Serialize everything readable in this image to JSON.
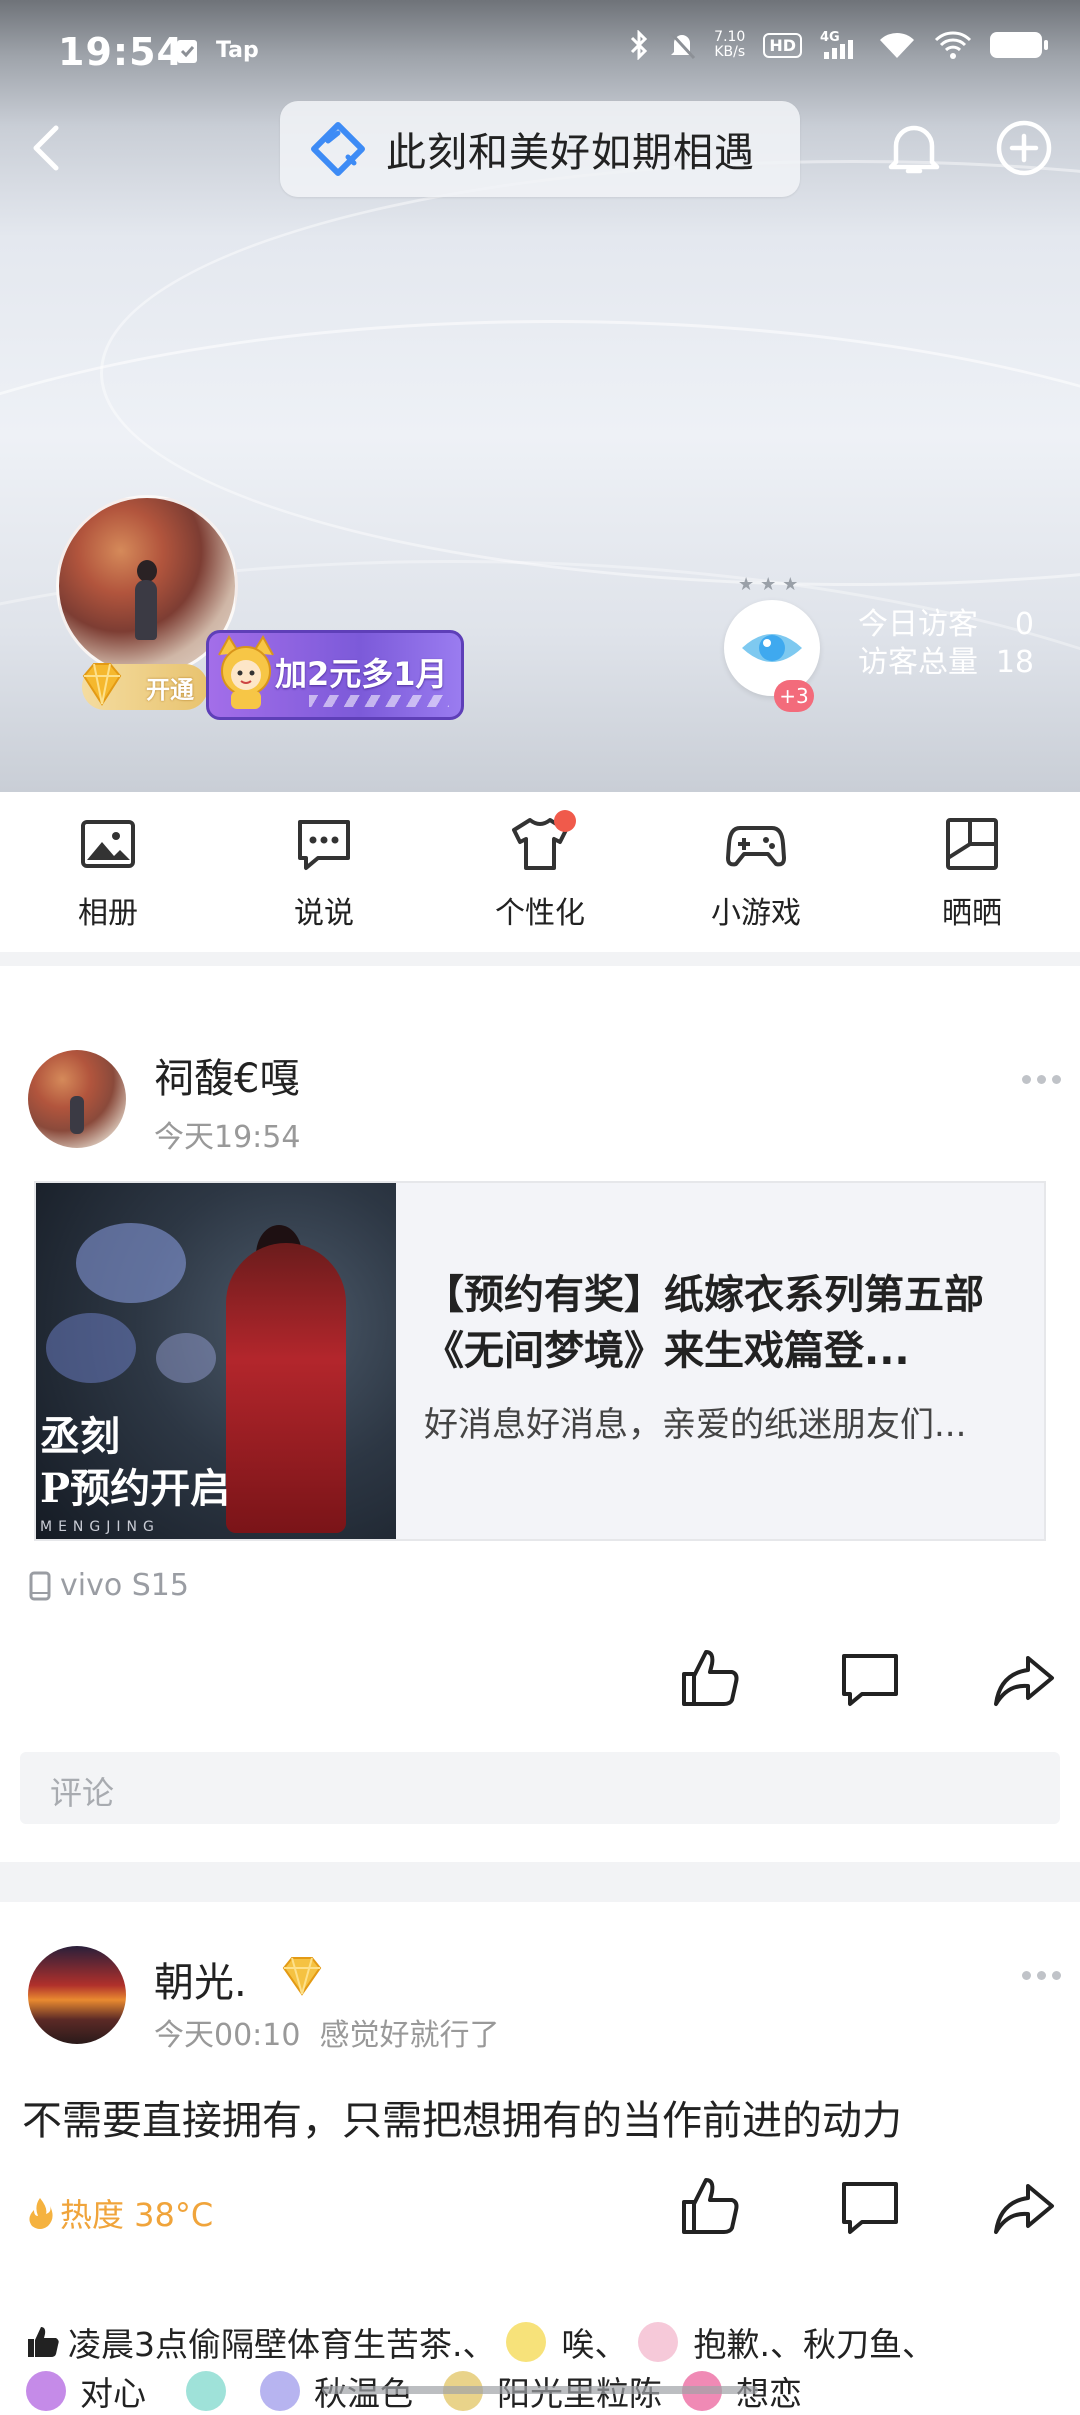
{
  "status_bar": {
    "time": "19:54",
    "app_label": "Tap",
    "net_speed_value": "7.10",
    "net_speed_unit": "KB/s",
    "hd": "HD",
    "signal": "4G"
  },
  "header": {
    "title": "此刻和美好如期相遇"
  },
  "profile": {
    "vip_open_label": "开通",
    "promo_label": "加2元多1月",
    "visitor_badge": "+3",
    "today_visitors_label": "今日访客",
    "today_visitors_value": "0",
    "total_visitors_label": "访客总量",
    "total_visitors_value": "18"
  },
  "features": [
    {
      "label": "相册",
      "icon": "album-icon"
    },
    {
      "label": "说说",
      "icon": "chat-icon"
    },
    {
      "label": "个性化",
      "icon": "tshirt-icon"
    },
    {
      "label": "小游戏",
      "icon": "gamepad-icon"
    },
    {
      "label": "晒晒",
      "icon": "collage-icon"
    }
  ],
  "post1": {
    "name": "祠馥€嘎",
    "time": "今天19:54",
    "link_title": "【预约有奖】纸嫁衣系列第五部《无间梦境》来生戏篇登...",
    "link_desc": "好消息好消息，亲爱的纸迷朋友们...",
    "thumb_text_line1": "丞刻",
    "thumb_text_line2": "P预约开启",
    "thumb_pinyin": "MENGJING",
    "device": "vivo S15",
    "comment_placeholder": "评论"
  },
  "post2": {
    "name": "朝光.",
    "time": "今天00:10",
    "mood": "感觉好就行了",
    "text": "不需要直接拥有，只需把想拥有的当作前进的动力",
    "heat_label": "热度 38°C"
  },
  "likes": {
    "line1_part1": "凌晨3点偷隔壁体育生苦茶.、",
    "line1_part2": "唉、",
    "line1_part3": "抱歉.、秋刀鱼、",
    "line2_part1": "对心",
    "line2_part2": "秋温色",
    "line2_part3": "阳光里粒陈",
    "line2_part4": "想恋"
  },
  "colors": {
    "accent_blue": "#3d8bf5",
    "vip_gold": "#e8c36f",
    "promo_purple": "#8a62e3",
    "heat_orange": "#f0a43b",
    "badge_red": "#f36b7b"
  }
}
